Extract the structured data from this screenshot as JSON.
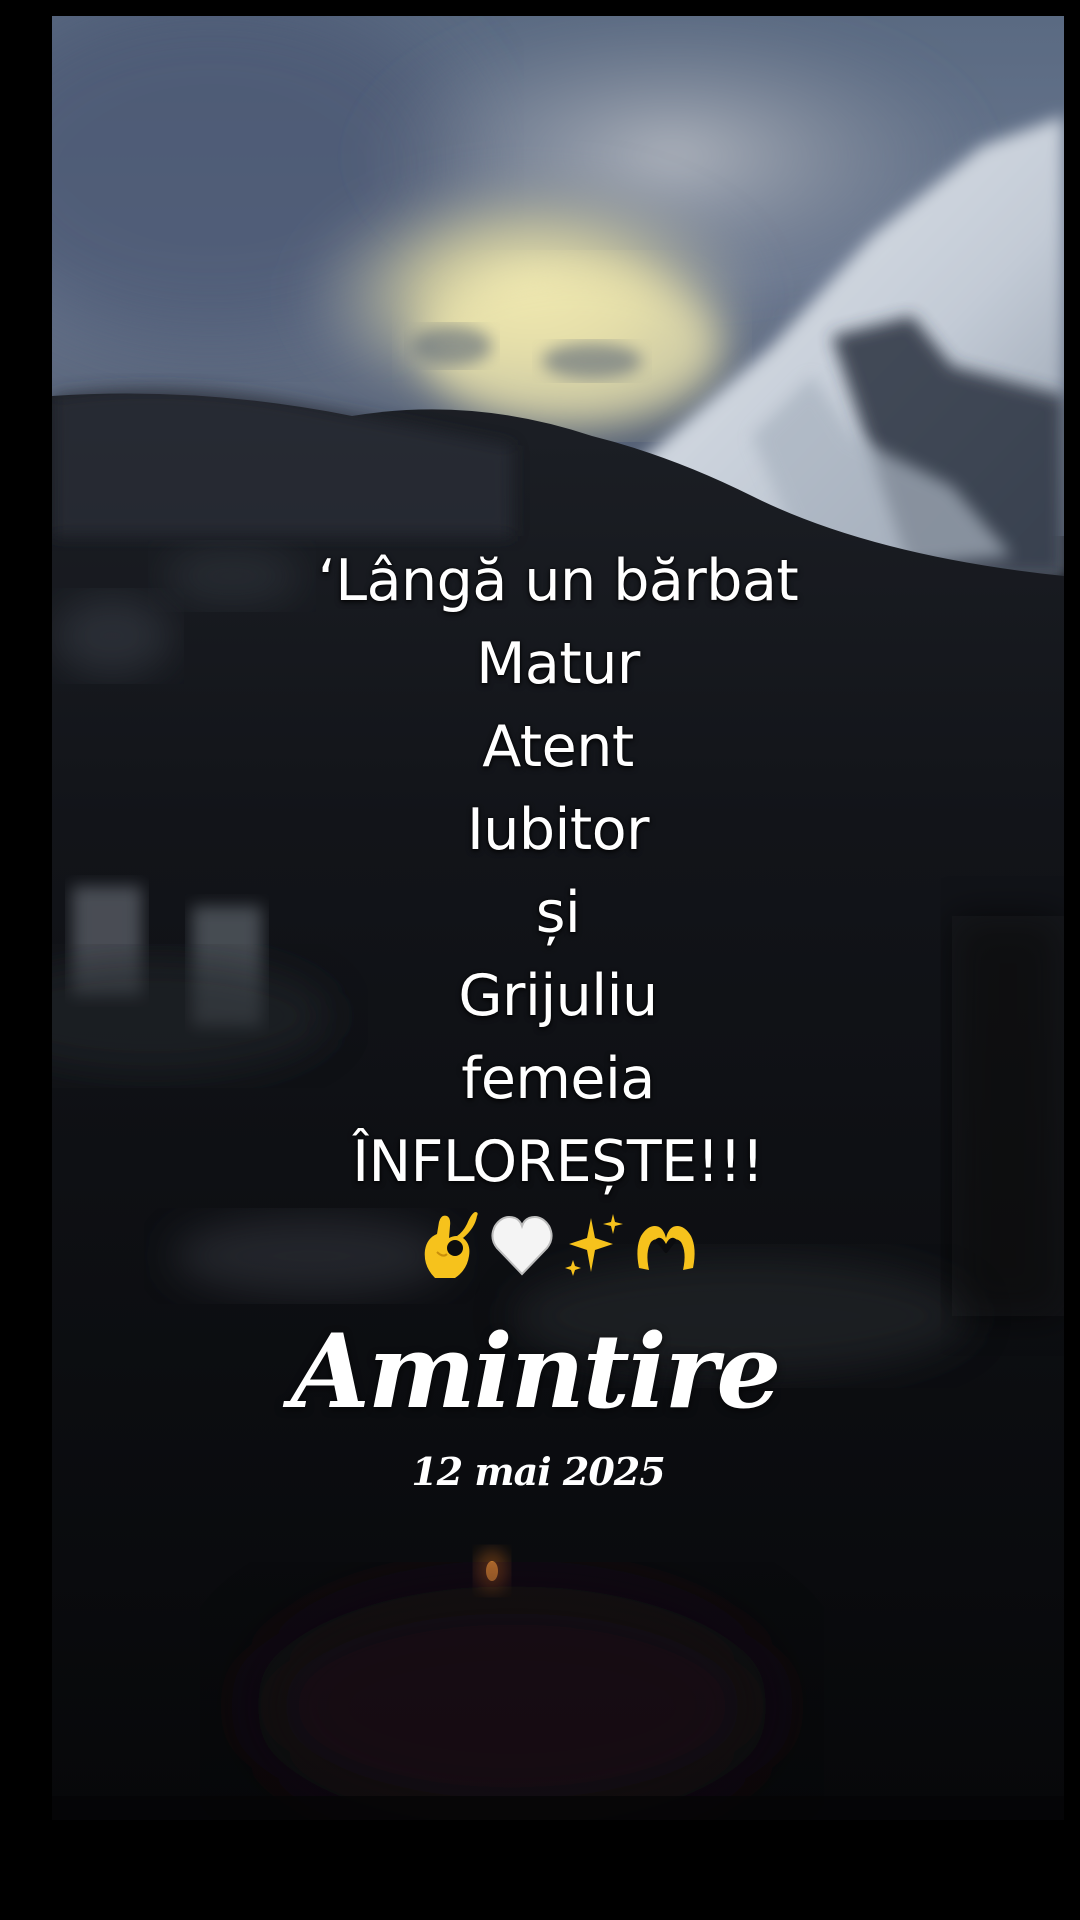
{
  "scene": {
    "background": "night mountain landscape with snowy peak and moonlit clouds"
  },
  "poem": {
    "lines": [
      "‘Lângă un bărbat",
      "Matur",
      "Atent",
      "Iubitor",
      "și",
      "Grijuliu",
      "femeia",
      "ÎNFLOREȘTE!!!"
    ],
    "emojis": [
      "ok-hand-icon",
      "white-heart-icon",
      "sparkles-icon",
      "heart-hands-icon"
    ]
  },
  "overlay": {
    "title": "Amintire",
    "date": "12 mai 2025"
  },
  "colors": {
    "text": "#ffffff",
    "frame": "#000000",
    "moonlight": "#e8e0a8",
    "snow": "#d6dde6",
    "emoji_yellow": "#f6c21c"
  }
}
